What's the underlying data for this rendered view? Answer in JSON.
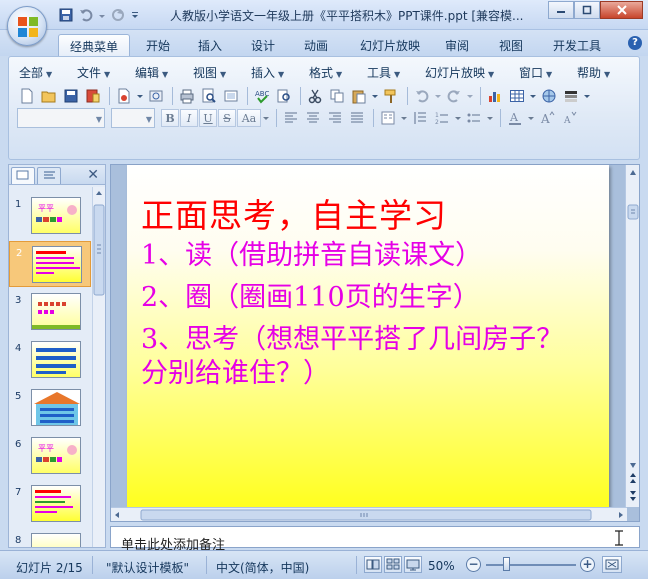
{
  "window": {
    "title": "人教版小学语文一年级上册《平平搭积木》PPT课件.ppt [兼容模..."
  },
  "ribbon_tabs": [
    {
      "label": "经典菜单",
      "active": true
    },
    {
      "label": "开始"
    },
    {
      "label": "插入"
    },
    {
      "label": "设计"
    },
    {
      "label": "动画"
    },
    {
      "label": "幻灯片放映"
    },
    {
      "label": "审阅"
    },
    {
      "label": "视图"
    },
    {
      "label": "开发工具"
    }
  ],
  "help_label": "?",
  "menu": [
    "全部",
    "文件",
    "编辑",
    "视图",
    "插入",
    "格式",
    "工具",
    "幻灯片放映",
    "窗口",
    "帮助"
  ],
  "format_buttons": [
    "B",
    "I",
    "U",
    "S",
    "Aa"
  ],
  "thumbnails": [
    {
      "number": "1"
    },
    {
      "number": "2",
      "selected": true
    },
    {
      "number": "3"
    },
    {
      "number": "4"
    },
    {
      "number": "5"
    },
    {
      "number": "6"
    },
    {
      "number": "7"
    },
    {
      "number": "8"
    }
  ],
  "slide": {
    "title": "正面思考，自主学习",
    "lines": [
      "1、读（借助拼音自读课文）",
      "2、圈（圈画110页的生字）",
      "3、思考（想想平平搭了几间房子？",
      "分别给谁住？）"
    ],
    "title_color": "#ff0000",
    "body_color": "#e600e6"
  },
  "notes": {
    "placeholder": "单击此处添加备注"
  },
  "status": {
    "slide_info": "幻灯片 2/15",
    "template": "\"默认设计模板\"",
    "language": "中文(简体，中国)",
    "zoom": "50%",
    "zoom_minus": "−",
    "zoom_plus": "+",
    "zoom_level": 0.5
  },
  "colors": {
    "ribbon_bg": "#dfe9f6",
    "selected_thumb": "#f7c87a",
    "accent": "#2a61b0"
  }
}
